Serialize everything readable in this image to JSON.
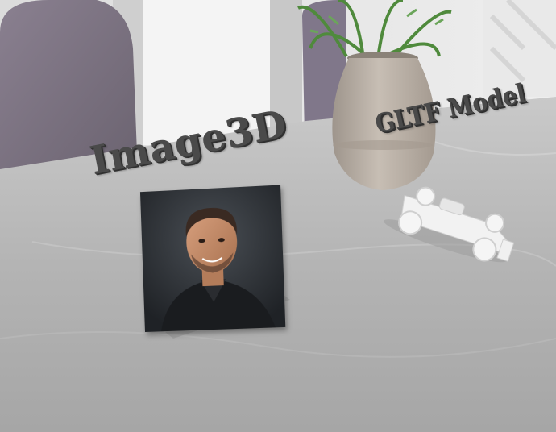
{
  "scene": {
    "labels": {
      "image3d": "Image3D",
      "gltf_model": "GLTF Model"
    },
    "icons": [
      "portrait-photo-icon",
      "race-car-model-icon",
      "potted-plant-icon"
    ],
    "colors": {
      "table": "#bdbdbd",
      "label_text": "#4a4a4a",
      "wall": "#e6e6e6",
      "chair": "#7d7280",
      "vase": "#b9b0a6",
      "plant": "#4f8a3c",
      "car": "#f2f2f2"
    }
  }
}
